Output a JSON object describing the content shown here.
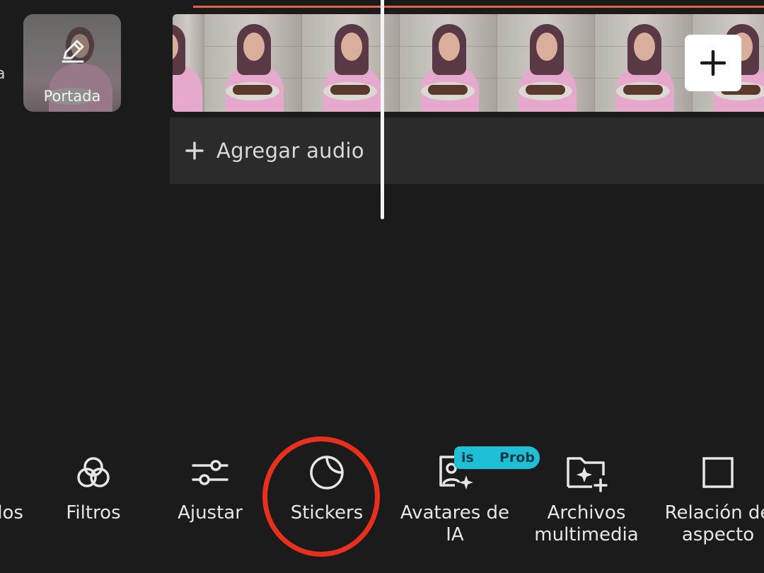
{
  "left_edge_text": "a",
  "cover": {
    "label": "Portada"
  },
  "timeline": {
    "add_audio_label": "Agregar audio"
  },
  "toolbar": {
    "items": [
      {
        "id": "partial",
        "label": "dos"
      },
      {
        "id": "filters",
        "label": "Filtros"
      },
      {
        "id": "adjust",
        "label": "Ajustar"
      },
      {
        "id": "stickers",
        "label": "Stickers"
      },
      {
        "id": "ai-avatars",
        "label_line1": "Avatares de",
        "label_line2": "IA"
      },
      {
        "id": "media",
        "label_line1": "Archivos",
        "label_line2": "multimedia"
      },
      {
        "id": "aspect",
        "label_line1": "Relación de",
        "label_line2": "aspecto"
      }
    ],
    "badge": {
      "text_left": "is",
      "text_right": "Prob",
      "color": "#1ec0d7"
    }
  },
  "colors": {
    "background": "#1b1b1b",
    "audio_row": "#2b2b2b",
    "progress_line": "#e4624a",
    "highlight": "#e8301c"
  }
}
